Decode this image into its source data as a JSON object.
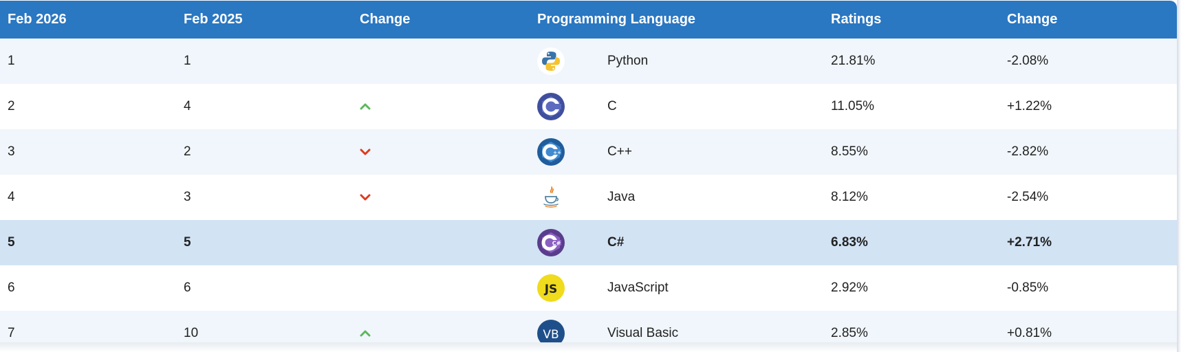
{
  "columns": {
    "current": "Feb 2026",
    "previous": "Feb 2025",
    "change": "Change",
    "language": "Programming Language",
    "ratings": "Ratings",
    "ratings_change": "Change"
  },
  "rows": [
    {
      "current": "1",
      "previous": "1",
      "trend": "none",
      "logo": "python-icon",
      "language": "Python",
      "rating": "21.81%",
      "change": "-2.08%"
    },
    {
      "current": "2",
      "previous": "4",
      "trend": "up",
      "logo": "c-icon",
      "language": "C",
      "rating": "11.05%",
      "change": "+1.22%"
    },
    {
      "current": "3",
      "previous": "2",
      "trend": "down",
      "logo": "cpp-icon",
      "language": "C++",
      "rating": "8.55%",
      "change": "-2.82%"
    },
    {
      "current": "4",
      "previous": "3",
      "trend": "down",
      "logo": "java-icon",
      "language": "Java",
      "rating": "8.12%",
      "change": "-2.54%"
    },
    {
      "current": "5",
      "previous": "5",
      "trend": "none",
      "logo": "csharp-icon",
      "language": "C#",
      "rating": "6.83%",
      "change": "+2.71%"
    },
    {
      "current": "6",
      "previous": "6",
      "trend": "none",
      "logo": "javascript-icon",
      "language": "JavaScript",
      "rating": "2.92%",
      "change": "-0.85%"
    },
    {
      "current": "7",
      "previous": "10",
      "trend": "up",
      "logo": "visual-basic-icon",
      "language": "Visual Basic",
      "rating": "2.85%",
      "change": "+0.81%"
    }
  ],
  "logo_text": {
    "csharp": "C#",
    "javascript": "JS",
    "visual_basic": "VB"
  },
  "colors": {
    "header": "#2a77c2",
    "up_arrow": "#5cb85c",
    "down_arrow": "#e0391f",
    "highlight_row": "#d2e3f4"
  }
}
